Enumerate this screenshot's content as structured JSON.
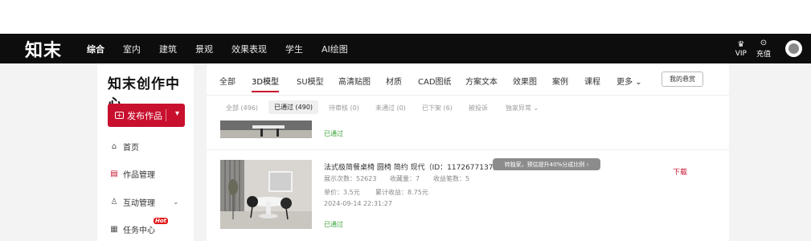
{
  "nav": {
    "logo": "知末",
    "items": [
      "综合",
      "室内",
      "建筑",
      "景观",
      "效果表现",
      "学生",
      "AI绘图"
    ],
    "vip_label": "VIP",
    "recharge_label": "充值"
  },
  "sidebar": {
    "title": "知末创作中心",
    "publish_label": "发布作品",
    "items": [
      {
        "label": "首页",
        "icon": "home-icon"
      },
      {
        "label": "作品管理",
        "icon": "works-icon"
      },
      {
        "label": "互动管理",
        "icon": "user-icon"
      },
      {
        "label": "任务中心",
        "icon": "task-icon"
      }
    ],
    "hot_badge": "Hot"
  },
  "tabs": [
    "全部",
    "3D模型",
    "SU模型",
    "高清贴图",
    "材质",
    "CAD图纸",
    "方案文本",
    "效果图",
    "案例",
    "课程",
    "更多"
  ],
  "reward_label": "我的悬赏",
  "subtabs": [
    "全部 (496)",
    "已通过 (490)",
    "待审核 (0)",
    "未通过 (0)",
    "已下架 (6)",
    "被投诉",
    "独家异常"
  ],
  "row1": {
    "status": "已通过"
  },
  "item": {
    "title": "法式极简餐桌椅 圆椅 简约 现代（ID：1172677137）",
    "promo": "转独家，预估提升40%分成比例",
    "views_label": "展示次数：",
    "views": "52623",
    "favs_label": "收藏量：",
    "favs": "7",
    "income_count_label": "收益笔数：",
    "income_count": "5",
    "price_label": "单价：",
    "price": "3.5元",
    "total_label": "累计收益：",
    "total": "8.75元",
    "date": "2024-09-14 22:31:27",
    "status": "已通过",
    "download": "下载"
  },
  "colors": {
    "accent": "#c8102e",
    "success": "#3aa33a",
    "nav_bg": "#0d0d0d"
  }
}
